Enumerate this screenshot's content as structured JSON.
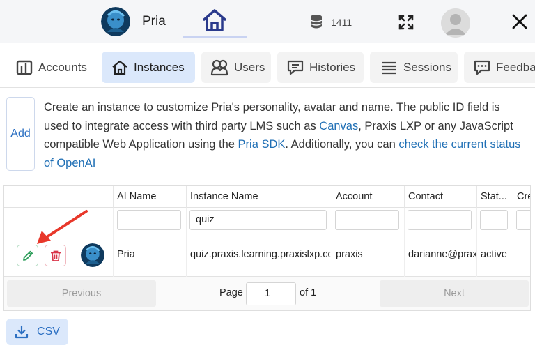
{
  "header": {
    "brand_name": "Pria",
    "db_count": "1411"
  },
  "tabs": [
    {
      "label": "Accounts",
      "icon": "bar-chart-icon",
      "active": false
    },
    {
      "label": "Instances",
      "icon": "home-icon",
      "active": true
    },
    {
      "label": "Users",
      "icon": "users-icon",
      "active": false
    },
    {
      "label": "Histories",
      "icon": "chat-icon",
      "active": false
    },
    {
      "label": "Sessions",
      "icon": "list-icon",
      "active": false
    },
    {
      "label": "Feedba",
      "icon": "feedback-icon",
      "active": false
    }
  ],
  "info": {
    "add_label": "Add",
    "t1": "Create an instance to customize Pria's personality, avatar and name. The public ID field is used to integrate access with third party LMS such as ",
    "link_canvas": "Canvas",
    "t2": ", Praxis LXP or any JavaScript compatible Web Application using the ",
    "link_sdk": "Pria SDK",
    "t3": ". Additionally, you can ",
    "link_status": "check the current status of OpenAI"
  },
  "table": {
    "columns": [
      "AI Name",
      "Instance Name",
      "Account",
      "Contact",
      "Stat...",
      "Cre"
    ],
    "filters": {
      "ai_name": "",
      "instance_name": "quiz",
      "account": "",
      "contact": "",
      "status": "",
      "created": ""
    },
    "rows": [
      {
        "ai_name": "Pria",
        "instance_name": "quiz.praxis.learning.praxislxp.com",
        "account": "praxis",
        "contact": "darianne@praxislxp.com",
        "status": "active"
      }
    ]
  },
  "pager": {
    "previous": "Previous",
    "page_label": "Page",
    "page_value": "1",
    "of_label": "of 1",
    "next": "Next"
  },
  "csv_label": "CSV",
  "colors": {
    "accent": "#2b6fc2",
    "tab_active": "#dbe8fb",
    "edit_green": "#2e9e5b",
    "delete_red": "#d9364a",
    "arrow_red": "#e8372a",
    "home_navy": "#2a3a8c"
  }
}
